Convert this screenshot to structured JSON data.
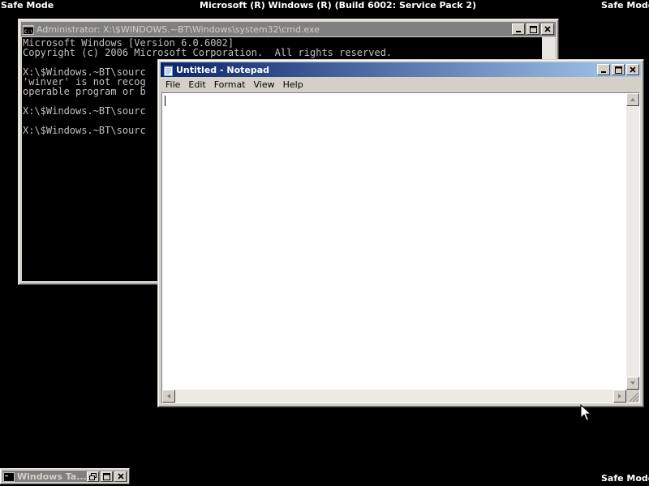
{
  "desktop": {
    "safe_mode_top_left": "Safe Mode",
    "safe_mode_top_right": "Safe Mode",
    "safe_mode_bottom_right": "Safe Mode",
    "build_banner": "Microsoft (R) Windows (R) (Build 6002: Service Pack 2)"
  },
  "cmd_window": {
    "title": "Administrator: X:\\$WINDOWS.~BT\\Windows\\system32\\cmd.exe",
    "lines": [
      "Microsoft Windows [Version 6.0.6002]",
      "Copyright (c) 2006 Microsoft Corporation.  All rights reserved.",
      "",
      "X:\\$Windows.~BT\\sourc",
      "'winver' is not recog",
      "operable program or b",
      "",
      "X:\\$Windows.~BT\\sourc",
      "",
      "X:\\$Windows.~BT\\sourc"
    ]
  },
  "notepad_window": {
    "title": "Untitled - Notepad",
    "menu": [
      "File",
      "Edit",
      "Format",
      "View",
      "Help"
    ],
    "content": ""
  },
  "minimized_window": {
    "title": "Windows Ta..."
  },
  "icons": {
    "cmd": "console-icon",
    "notepad": "notepad-icon",
    "cursor": "mouse-pointer-icon"
  },
  "colors": {
    "desktop": "#000000",
    "title_active_start": "#0a246a",
    "title_active_end": "#a6caf0",
    "title_inactive": "#808080",
    "window_face": "#d4d0c8",
    "console_text": "#c0c0c0"
  }
}
